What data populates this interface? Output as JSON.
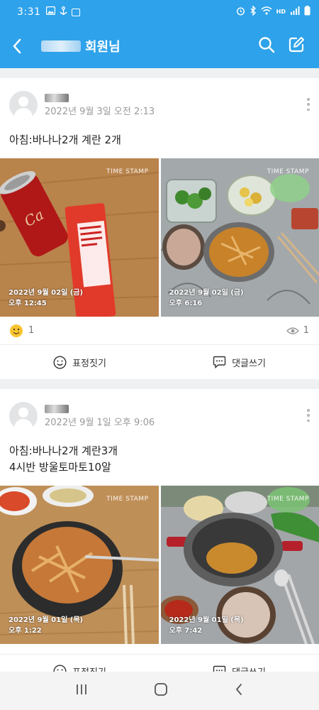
{
  "status": {
    "time": "3:31",
    "left_icons": [
      "image-icon",
      "anchor-icon",
      "app-badge-icon"
    ],
    "right_icons": [
      "alarm-icon",
      "bluetooth-icon",
      "wifi-icon",
      "hd-voice-icon",
      "signal-icon",
      "battery-icon"
    ]
  },
  "header": {
    "title_suffix": "회원님",
    "search_icon": "search-icon",
    "write_icon": "edit-icon"
  },
  "posts": [
    {
      "date": "2022년 9월 3일 오전 2:13",
      "text": "아침:바나나2개 계란 2개",
      "photos": [
        {
          "stamp": "TIME STAMP",
          "date": "2022년 9월 02일 (금)",
          "time": "오후 12:45"
        },
        {
          "stamp": "TIME STAMP",
          "date": "2022년 9월 02일 (금)",
          "time": "오후 6:16"
        }
      ],
      "reaction_count": "1",
      "view_count": "1",
      "react_label": "표정짓기",
      "comment_label": "댓글쓰기"
    },
    {
      "date": "2022년 9월 1일 오후 9:06",
      "text": "아침:바나나2개 계란3개\n4시반 방울토마토10알",
      "photos": [
        {
          "stamp": "TIME STAMP",
          "date": "2022년 9월 01일 (목)",
          "time": "오후 1:22"
        },
        {
          "stamp": "TIME STAMP",
          "date": "2022년 9월 01일 (목)",
          "time": "오후 7:42"
        }
      ],
      "react_label": "표정짓기",
      "comment_label": "댓글쓰기"
    }
  ],
  "colors": {
    "header": "#2ea2ea",
    "background": "#eef0f2"
  }
}
